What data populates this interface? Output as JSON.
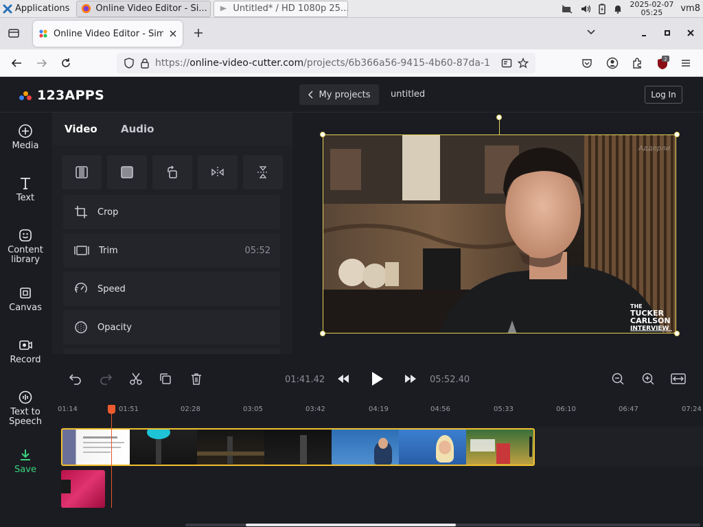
{
  "taskbar": {
    "apps_label": "Applications",
    "task1_label": "Online Video Editor - Si...",
    "task2_label": "Untitled* / HD 1080p 25...",
    "date": "2025-02-07",
    "time": "05:25",
    "user": "vm8"
  },
  "browser": {
    "tab_title": "Online Video Editor - Sim",
    "url_scheme": "https://",
    "url_host": "online-video-cutter.com",
    "url_path": "/projects/6b366a56-9415-4b60-87da-1",
    "extension_badge": "2"
  },
  "app": {
    "logo_text": "123APPS",
    "my_projects_label": "My projects",
    "project_name": "untitled",
    "login_label": "Log In",
    "nav": [
      {
        "label": "Media",
        "icon": "plus-circle-icon"
      },
      {
        "label": "Text",
        "icon": "text-icon"
      },
      {
        "label": "Content library",
        "icon": "sticker-icon"
      },
      {
        "label": "Canvas",
        "icon": "canvas-icon"
      },
      {
        "label": "Record",
        "icon": "record-icon"
      },
      {
        "label": "Text to Speech",
        "icon": "speech-icon"
      },
      {
        "label": "Save",
        "icon": "download-icon"
      }
    ],
    "panel_tabs": {
      "video": "Video",
      "audio": "Audio"
    },
    "tools": [
      {
        "label": "Crop",
        "meta": ""
      },
      {
        "label": "Trim",
        "meta": "05:52"
      },
      {
        "label": "Speed",
        "meta": ""
      },
      {
        "label": "Opacity",
        "meta": ""
      }
    ],
    "preview": {
      "watermark": "Аддерли",
      "overlay_line1": "THE",
      "overlay_line2": "TUCKER",
      "overlay_line3": "CARLSON",
      "overlay_line4": "INTERVIEW"
    },
    "player": {
      "current_time": "01:41.42",
      "total_time": "05:52.40"
    },
    "ruler_ticks": [
      "01:14",
      "01:51",
      "02:28",
      "03:05",
      "03:42",
      "04:19",
      "04:56",
      "05:33",
      "06:10",
      "06:47",
      "07:24"
    ]
  },
  "colors": {
    "accent_yellow": "#f2c12e",
    "save_green": "#39d37d",
    "playhead": "#ec5b2f"
  }
}
